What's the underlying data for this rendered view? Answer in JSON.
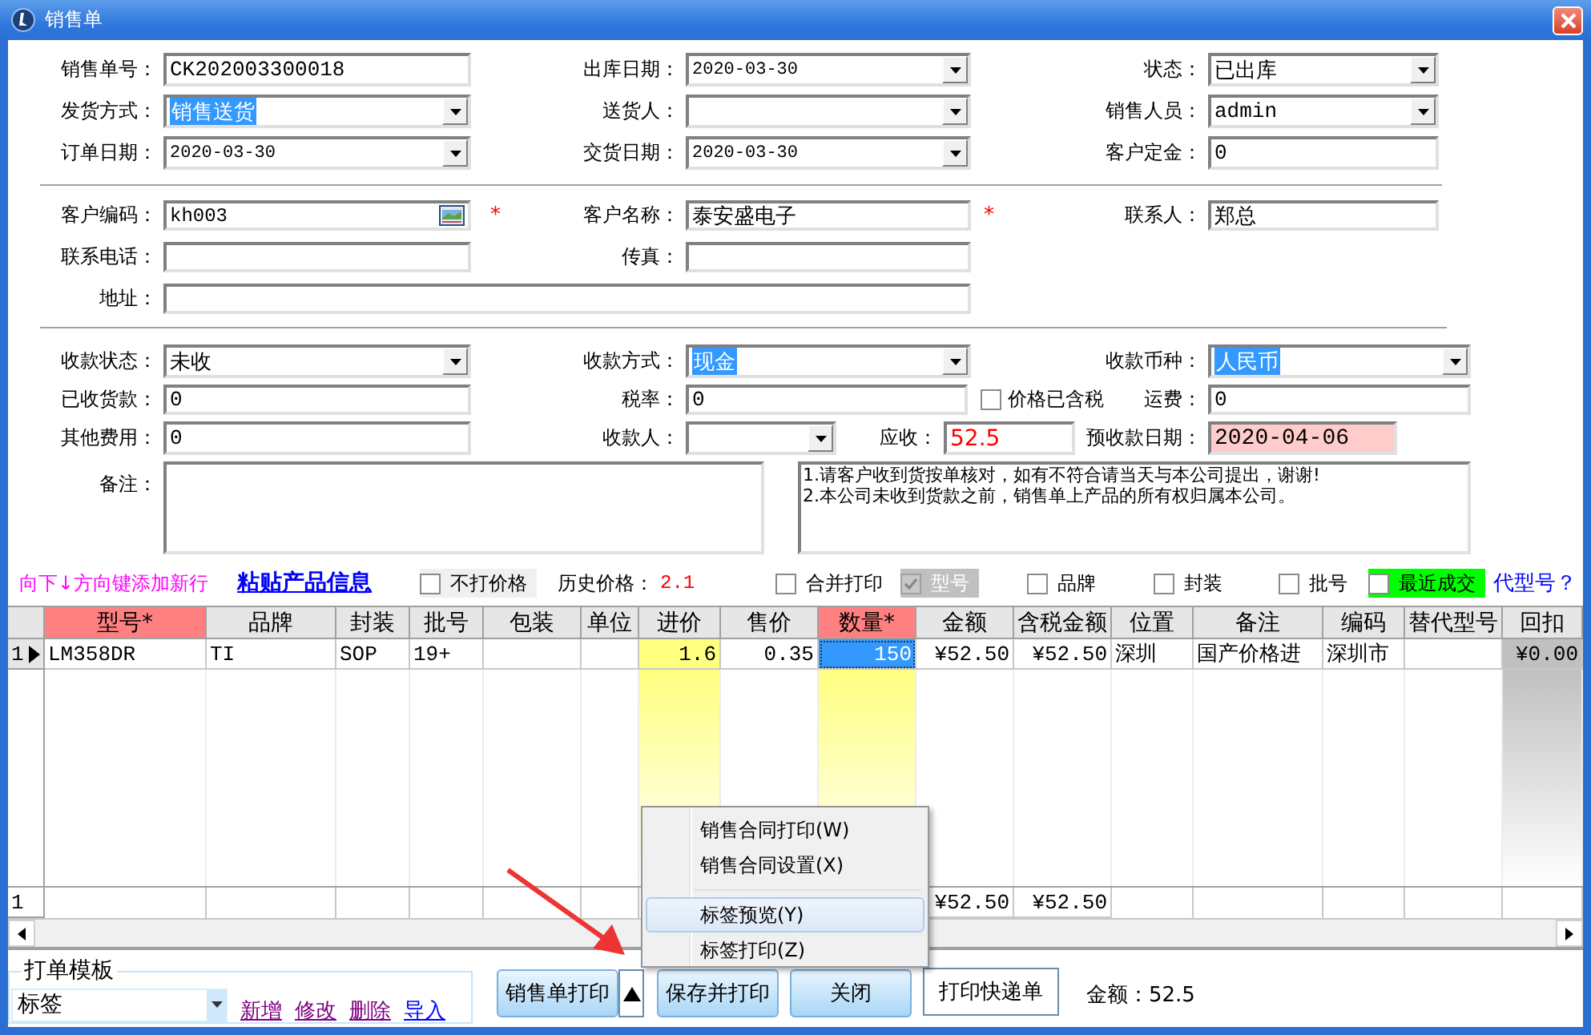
{
  "window": {
    "title": "销售单"
  },
  "order": [
    [
      {
        "label": "销售单号：",
        "kind": "text",
        "value": "CK202003300018",
        "text_selected": false
      },
      {
        "label": "出库日期：",
        "kind": "date",
        "value": "2020-03-30",
        "text_selected": false
      },
      {
        "label": "状态：",
        "kind": "combo",
        "value": "已出库",
        "text_selected": false
      }
    ],
    [
      {
        "label": "发货方式：",
        "kind": "combo",
        "value": "销售送货",
        "text_selected": true
      },
      {
        "label": "送货人：",
        "kind": "combo"
      },
      {
        "label": "销售人员：",
        "kind": "combo",
        "value": "admin",
        "text_selected": false
      }
    ],
    [
      {
        "label": "订单日期：",
        "kind": "date",
        "value": "2020-03-30",
        "text_selected": false
      },
      {
        "label": "交货日期：",
        "kind": "date",
        "value": "2020-03-30",
        "text_selected": false
      },
      {
        "label": "客户定金：",
        "kind": "text",
        "value": "0",
        "text_selected": false
      }
    ]
  ],
  "customer": [
    [
      {
        "label": "客户编码：",
        "kind": "lookup",
        "value": "kh003",
        "text_selected": false,
        "required_mark": "*"
      },
      {
        "label": "客户名称：",
        "kind": "text",
        "value": "泰安盛电子",
        "text_selected": false,
        "required_mark": "*"
      },
      {
        "label": "联系人：",
        "kind": "text",
        "value": "郑总",
        "text_selected": false
      }
    ],
    [
      {
        "label": "联系电话：",
        "kind": "text"
      },
      {
        "label": "传真：",
        "kind": "text"
      }
    ],
    [
      {
        "label": "地址：",
        "kind": "text"
      }
    ]
  ],
  "payment": [
    [
      {
        "label": "收款状态：",
        "kind": "combo",
        "value": "未收",
        "text_selected": false
      },
      {
        "label": "收款方式：",
        "kind": "combo",
        "value": "现金",
        "text_selected": true
      },
      {
        "label": "收款币种：",
        "kind": "combo",
        "value": "人民币",
        "text_selected": true
      }
    ],
    [
      {
        "label": "已收货款：",
        "kind": "text",
        "value": "0",
        "text_selected": false
      },
      {
        "label": "税率：",
        "kind": "text",
        "value": "0",
        "text_selected": false
      },
      {
        "label": "价格已含税",
        "kind": "checkbox",
        "checked": false
      },
      {
        "label": "运费：",
        "kind": "text",
        "value": "0",
        "text_selected": false
      }
    ],
    [
      {
        "label": "其他费用：",
        "kind": "text",
        "value": "0",
        "text_selected": false,
        "alert": false,
        "warning": false
      },
      {
        "label": "收款人：",
        "kind": "combo"
      },
      {
        "label": "应收：",
        "kind": "text",
        "value": "52.5",
        "alert": true,
        "warning": false,
        "text_selected": false
      },
      {
        "label": "预收款日期：",
        "kind": "text",
        "value": "2020-04-06",
        "alert": false,
        "warning": true,
        "text_selected": false
      }
    ],
    [
      {
        "label": "备注：",
        "kind": "memo"
      },
      {
        "kind": "memo",
        "lines": [
          "1.请客户收到货按单核对，如有不符合请当天与本公司提出，谢谢!",
          "2.本公司未收到货款之前，销售单上产品的所有权归属本公司。"
        ]
      }
    ]
  ],
  "item_toolbar": [
    {
      "kind": "hint",
      "text": "向下↓方向键添加新行"
    },
    {
      "kind": "link",
      "text": "粘贴产品信息"
    },
    {
      "kind": "checkbox",
      "label": "不打价格",
      "checked": false,
      "disabled": false,
      "color": "#f0f0f0"
    },
    {
      "kind": "label",
      "text": "历史价格："
    },
    {
      "kind": "value",
      "text": "2.1"
    },
    {
      "kind": "checkbox",
      "label": "合并打印",
      "checked": false,
      "disabled": false
    },
    {
      "kind": "checkbox",
      "label": "型号",
      "checked": true,
      "disabled": true,
      "color": "#c0c0c0"
    },
    {
      "kind": "checkbox",
      "label": "品牌",
      "checked": false,
      "disabled": false
    },
    {
      "kind": "checkbox",
      "label": "封装",
      "checked": false,
      "disabled": false
    },
    {
      "kind": "checkbox",
      "label": "批号",
      "checked": false,
      "disabled": false
    },
    {
      "kind": "checkbox",
      "label": "最近成交",
      "checked": false,
      "disabled": false,
      "color": "#00ff00"
    },
    {
      "kind": "help_link",
      "text": "代型号？"
    }
  ],
  "table": {
    "columns": [
      {
        "title": "型号*",
        "required": true
      },
      {
        "title": "品牌",
        "required": false
      },
      {
        "title": "封装",
        "required": false
      },
      {
        "title": "批号",
        "required": false
      },
      {
        "title": "包装",
        "required": false
      },
      {
        "title": "单位",
        "required": false
      },
      {
        "title": "进价",
        "required": false,
        "kind": "number",
        "color": "#ffff80"
      },
      {
        "title": "售价",
        "required": false,
        "kind": "number"
      },
      {
        "title": "数量*",
        "required": true,
        "kind": "number",
        "color": "#ffff80"
      },
      {
        "title": "金额",
        "required": false,
        "kind": "number"
      },
      {
        "title": "含税金额",
        "required": false,
        "kind": "number"
      },
      {
        "title": "位置",
        "required": false
      },
      {
        "title": "备注",
        "required": false
      },
      {
        "title": "编码",
        "required": false
      },
      {
        "title": "替代型号",
        "required": false
      },
      {
        "title": "回扣",
        "required": false,
        "kind": "number",
        "color": "#c0c0c0"
      }
    ],
    "rows": [
      {
        "label": "1",
        "current": true,
        "cells": [
          {
            "text": "LM358DR",
            "selected": false
          },
          {
            "text": "TI",
            "selected": false
          },
          {
            "text": "SOP",
            "selected": false
          },
          {
            "text": "19+",
            "selected": false
          },
          {
            "selected": false
          },
          {
            "selected": false
          },
          {
            "text": "1.6",
            "selected": false
          },
          {
            "text": "0.35",
            "selected": false
          },
          {
            "text": "150",
            "selected": true
          },
          {
            "text": "¥52.50",
            "selected": false
          },
          {
            "text": "¥52.50",
            "selected": false
          },
          {
            "text": "深圳",
            "selected": false
          },
          {
            "text": "国产价格进",
            "selected": false
          },
          {
            "text": "深圳市",
            "selected": false
          },
          {
            "selected": false
          },
          {
            "text": "¥0.00",
            "selected": false
          }
        ]
      }
    ],
    "footer": {
      "label": "1",
      "cells": [
        null,
        null,
        null,
        null,
        null,
        null,
        null,
        null,
        null,
        "¥52.50",
        "¥52.50",
        null,
        null,
        null,
        null,
        null
      ]
    }
  },
  "print_template": {
    "title": "打单模板",
    "value": "标签",
    "links": [
      {
        "label": "新增",
        "visited": true
      },
      {
        "label": "修改",
        "visited": true
      },
      {
        "label": "删除",
        "visited": true
      },
      {
        "label": "导入",
        "visited": false
      }
    ]
  },
  "buttons": [
    {
      "label": "销售单打印",
      "kind": "split"
    },
    {
      "label": "保存并打印",
      "kind": "primary"
    },
    {
      "label": "关闭",
      "kind": "primary"
    },
    {
      "label": "打印快递单",
      "kind": "plain"
    }
  ],
  "total": "金额：52.5",
  "context_menu": [
    {
      "kind": "item",
      "label": "销售合同打印(W)",
      "selected": false
    },
    {
      "kind": "item",
      "label": "销售合同设置(X)",
      "selected": false
    },
    {
      "kind": "separator"
    },
    {
      "kind": "item",
      "label": "标签预览(Y)",
      "selected": true
    },
    {
      "kind": "item",
      "label": "标签打印(Z)",
      "selected": false
    }
  ]
}
